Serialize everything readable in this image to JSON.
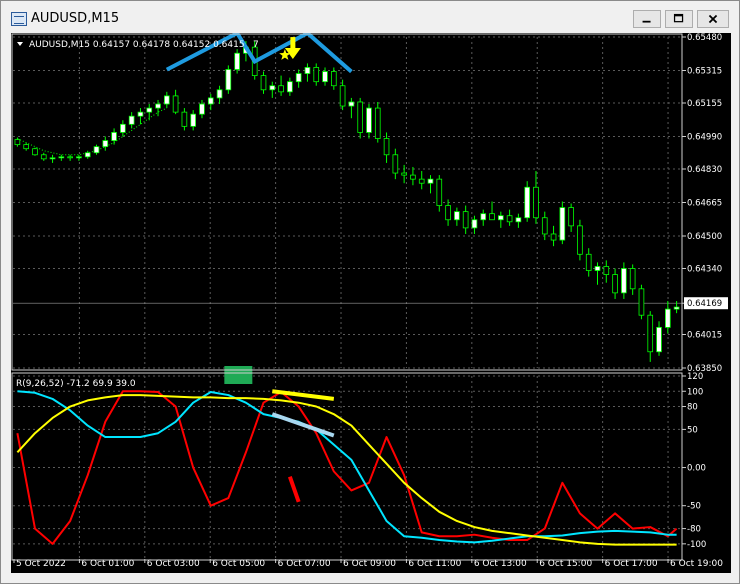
{
  "window": {
    "title": "AUDUSD,M15"
  },
  "colors": {
    "background": "#000000",
    "grid": "#5a5a5a",
    "bull": "#ffffff",
    "bear": "#000000",
    "wick": "#00ff00",
    "ma": "#00ff00",
    "red_line": "#ff0000",
    "cyan_line": "#00e5ff",
    "yellow_line": "#ffff00",
    "blue_annotation": "#1e9be0",
    "green_marker": "#1faa55",
    "label": "#ffffff"
  },
  "price_panel": {
    "info": "AUDUSD,M15  0.64157 0.64178 0.64152 0.6415",
    "info_tail": "7"
  },
  "indicator_panel": {
    "info": "R(9,26,52) -71.2 69.9 39.0"
  },
  "chart_data": [
    {
      "type": "candlestick",
      "title": "AUDUSD,M15",
      "y_ticks": [
        "0.65480",
        "0.65315",
        "0.65155",
        "0.64990",
        "0.64830",
        "0.64665",
        "0.64500",
        "0.64340",
        "0.64169",
        "0.64015",
        "0.63850"
      ],
      "y_tick_values": [
        0.6548,
        0.65315,
        0.65155,
        0.6499,
        0.6483,
        0.64665,
        0.645,
        0.6434,
        0.64169,
        0.64015,
        0.6385
      ],
      "ylim": [
        0.6385,
        0.6548
      ],
      "current_price": "0.64169",
      "x_labels": [
        "5 Oct 2022",
        "6 Oct 01:00",
        "6 Oct 03:00",
        "6 Oct 05:00",
        "6 Oct 07:00",
        "6 Oct 09:00",
        "6 Oct 11:00",
        "6 Oct 13:00",
        "6 Oct 15:00",
        "6 Oct 17:00",
        "6 Oct 19:00"
      ],
      "candles": [
        [
          0.64975,
          0.64985,
          0.6494,
          0.6495
        ],
        [
          0.6495,
          0.64958,
          0.6492,
          0.6493
        ],
        [
          0.6493,
          0.64935,
          0.64895,
          0.649
        ],
        [
          0.649,
          0.6491,
          0.6487,
          0.6488
        ],
        [
          0.6488,
          0.649,
          0.6486,
          0.64885
        ],
        [
          0.64885,
          0.649,
          0.6487,
          0.6489
        ],
        [
          0.6489,
          0.649,
          0.6487,
          0.64885
        ],
        [
          0.64885,
          0.649,
          0.6487,
          0.6489
        ],
        [
          0.6489,
          0.6492,
          0.6488,
          0.6491
        ],
        [
          0.6491,
          0.6495,
          0.649,
          0.6494
        ],
        [
          0.6494,
          0.6499,
          0.6492,
          0.6497
        ],
        [
          0.6497,
          0.6503,
          0.6495,
          0.6501
        ],
        [
          0.6501,
          0.6507,
          0.6499,
          0.6505
        ],
        [
          0.6505,
          0.6511,
          0.6503,
          0.6509
        ],
        [
          0.6509,
          0.6513,
          0.6505,
          0.6511
        ],
        [
          0.6511,
          0.6515,
          0.6507,
          0.6513
        ],
        [
          0.6513,
          0.6517,
          0.6509,
          0.6515
        ],
        [
          0.6515,
          0.6521,
          0.6513,
          0.6519
        ],
        [
          0.6519,
          0.6522,
          0.651,
          0.6511
        ],
        [
          0.6511,
          0.6513,
          0.6502,
          0.6504
        ],
        [
          0.6504,
          0.6512,
          0.6502,
          0.651
        ],
        [
          0.651,
          0.6517,
          0.6508,
          0.6515
        ],
        [
          0.6515,
          0.652,
          0.6512,
          0.6518
        ],
        [
          0.6518,
          0.6524,
          0.6515,
          0.6522
        ],
        [
          0.6522,
          0.6534,
          0.652,
          0.6532
        ],
        [
          0.6532,
          0.6542,
          0.653,
          0.654
        ],
        [
          0.654,
          0.6546,
          0.6536,
          0.6543
        ],
        [
          0.6543,
          0.6546,
          0.6527,
          0.6529
        ],
        [
          0.6529,
          0.6531,
          0.652,
          0.6522
        ],
        [
          0.6522,
          0.6526,
          0.6518,
          0.6524
        ],
        [
          0.6524,
          0.6529,
          0.6519,
          0.6521
        ],
        [
          0.6521,
          0.6528,
          0.6519,
          0.6526
        ],
        [
          0.6526,
          0.6532,
          0.6523,
          0.653
        ],
        [
          0.653,
          0.6535,
          0.6526,
          0.6533
        ],
        [
          0.6533,
          0.6535,
          0.6524,
          0.6526
        ],
        [
          0.6526,
          0.6533,
          0.6524,
          0.6531
        ],
        [
          0.6531,
          0.6533,
          0.6522,
          0.6524
        ],
        [
          0.6524,
          0.6527,
          0.6512,
          0.6514
        ],
        [
          0.6514,
          0.6518,
          0.6508,
          0.6516
        ],
        [
          0.6516,
          0.6518,
          0.6498,
          0.6501
        ],
        [
          0.6501,
          0.6515,
          0.6498,
          0.6513
        ],
        [
          0.6513,
          0.6516,
          0.6496,
          0.6498
        ],
        [
          0.6498,
          0.6501,
          0.6486,
          0.649
        ],
        [
          0.649,
          0.6493,
          0.6478,
          0.6481
        ],
        [
          0.6481,
          0.6485,
          0.6476,
          0.648
        ],
        [
          0.648,
          0.6484,
          0.6475,
          0.6478
        ],
        [
          0.6478,
          0.6482,
          0.6473,
          0.6476
        ],
        [
          0.6476,
          0.648,
          0.6471,
          0.6478
        ],
        [
          0.6478,
          0.648,
          0.6462,
          0.6465
        ],
        [
          0.6465,
          0.6468,
          0.6455,
          0.6458
        ],
        [
          0.6458,
          0.6464,
          0.6455,
          0.6462
        ],
        [
          0.6462,
          0.6465,
          0.6451,
          0.6454
        ],
        [
          0.6454,
          0.646,
          0.6451,
          0.6458
        ],
        [
          0.6458,
          0.6463,
          0.6455,
          0.6461
        ],
        [
          0.6461,
          0.6467,
          0.6458,
          0.6458
        ],
        [
          0.6458,
          0.6462,
          0.6454,
          0.646
        ],
        [
          0.646,
          0.6463,
          0.6455,
          0.6457
        ],
        [
          0.6457,
          0.6461,
          0.6454,
          0.6459
        ],
        [
          0.6459,
          0.6477,
          0.6457,
          0.6474
        ],
        [
          0.6474,
          0.6482,
          0.6456,
          0.6459
        ],
        [
          0.6459,
          0.6462,
          0.6448,
          0.6451
        ],
        [
          0.6451,
          0.6455,
          0.6445,
          0.6448
        ],
        [
          0.6448,
          0.6467,
          0.6446,
          0.6464
        ],
        [
          0.6464,
          0.6466,
          0.6452,
          0.6455
        ],
        [
          0.6455,
          0.6458,
          0.6438,
          0.6441
        ],
        [
          0.6441,
          0.6444,
          0.643,
          0.6433
        ],
        [
          0.6433,
          0.6437,
          0.6426,
          0.6435
        ],
        [
          0.6435,
          0.6438,
          0.6427,
          0.6431
        ],
        [
          0.6431,
          0.6434,
          0.6419,
          0.6422
        ],
        [
          0.6422,
          0.6437,
          0.6419,
          0.6434
        ],
        [
          0.6434,
          0.6436,
          0.6421,
          0.6424
        ],
        [
          0.6424,
          0.6426,
          0.6409,
          0.6411
        ],
        [
          0.6411,
          0.6413,
          0.6388,
          0.6393
        ],
        [
          0.6393,
          0.6408,
          0.6391,
          0.6405
        ],
        [
          0.6405,
          0.6418,
          0.6402,
          0.6414
        ],
        [
          0.6414,
          0.6418,
          0.6412,
          0.6415
        ]
      ],
      "ma_values": [
        0.6498,
        0.6496,
        0.6494,
        0.6492,
        0.6491,
        0.649,
        0.649,
        0.649,
        0.6491,
        0.6492,
        0.6494,
        0.6496,
        0.6499,
        0.6502,
        0.6505,
        0.6508,
        0.6511,
        0.6513,
        0.6514,
        0.6514,
        0.6514,
        0.6515,
        0.6516,
        0.6517,
        0.6519,
        0.6522,
        0.6525,
        0.6527,
        0.6527,
        0.6527,
        0.6527,
        0.6527,
        0.6527,
        0.6528,
        0.6528,
        0.6528,
        0.6527,
        0.6526,
        0.6524,
        0.6522,
        0.652,
        0.6517,
        0.6514,
        0.651,
        0.6506,
        0.6502,
        0.6498,
        0.6494,
        0.649,
        0.6486,
        0.6482,
        0.6478,
        0.6475,
        0.6472,
        0.647,
        0.6468,
        0.6466,
        0.6464,
        0.6464,
        0.6464,
        0.6462,
        0.646,
        0.6459,
        0.6458,
        0.6456,
        0.6453,
        0.645,
        0.6447,
        0.6444,
        0.6442,
        0.6439,
        0.6435,
        0.643,
        0.6426,
        0.6424,
        0.6422
      ],
      "ma_visible_points": 18,
      "annotation_points": [
        [
          0.6528,
          17
        ],
        [
          0.6546,
          25
        ],
        [
          0.6532,
          27
        ],
        [
          0.6546,
          33
        ],
        [
          0.6527,
          38
        ]
      ]
    },
    {
      "type": "line",
      "title": "R(9,26,52) -71.2 69.9 39.0",
      "ylim": [
        -112,
        120
      ],
      "y_ticks": [
        "120",
        "100",
        "80",
        "50",
        "0.00",
        "-50",
        "-80",
        "-100"
      ],
      "y_tick_values": [
        120,
        100,
        80,
        50,
        0,
        -50,
        -80,
        -100
      ],
      "x": [
        0,
        2,
        4,
        6,
        8,
        10,
        12,
        14,
        16,
        18,
        20,
        22,
        24,
        26,
        28,
        30,
        32,
        34,
        36,
        38,
        40,
        42,
        44,
        46,
        48,
        50,
        52,
        54,
        56,
        58,
        60,
        62,
        64,
        66,
        68,
        70,
        72,
        74,
        75
      ],
      "series": [
        {
          "color": "#ff0000",
          "values": [
            45,
            -80,
            -100,
            -70,
            -10,
            60,
            100,
            100,
            99,
            80,
            0,
            -50,
            -40,
            20,
            85,
            99,
            80,
            45,
            -5,
            -30,
            -20,
            40,
            -10,
            -85,
            -90,
            -90,
            -88,
            -92,
            -95,
            -95,
            -80,
            -20,
            -60,
            -80,
            -60,
            -80,
            -78,
            -90,
            -80
          ]
        },
        {
          "color": "#00e5ff",
          "values": [
            100,
            98,
            90,
            75,
            55,
            40,
            40,
            40,
            45,
            60,
            85,
            99,
            95,
            85,
            70,
            65,
            60,
            50,
            30,
            10,
            -30,
            -70,
            -90,
            -92,
            -95,
            -97,
            -98,
            -96,
            -93,
            -90,
            -90,
            -89,
            -86,
            -84,
            -83,
            -84,
            -85,
            -88,
            -88
          ]
        },
        {
          "color": "#ffff00",
          "values": [
            20,
            45,
            65,
            80,
            88,
            92,
            95,
            95,
            94,
            93,
            92,
            92,
            91,
            91,
            90,
            88,
            85,
            80,
            70,
            55,
            30,
            5,
            -20,
            -40,
            -58,
            -70,
            -78,
            -83,
            -86,
            -89,
            -92,
            -95,
            -98,
            -100,
            -101,
            -101,
            -101,
            -101,
            -101
          ]
        }
      ]
    }
  ]
}
